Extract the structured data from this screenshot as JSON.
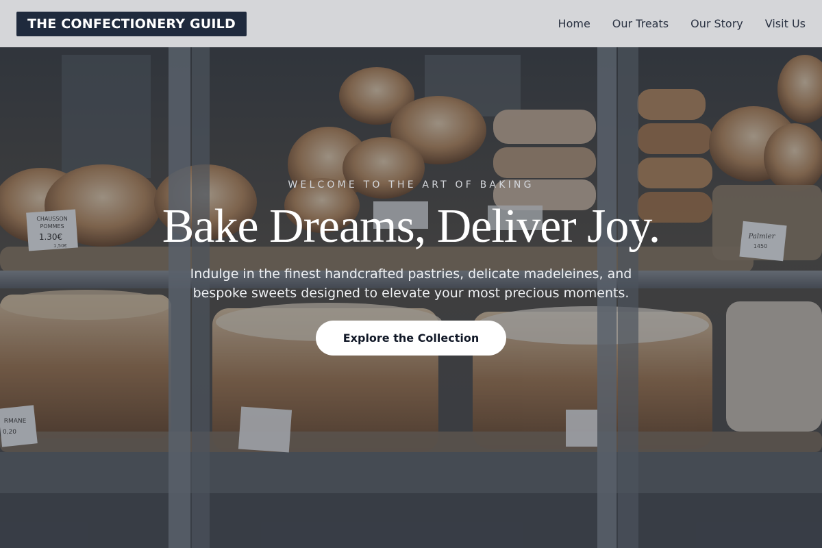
{
  "header": {
    "logo_text": "THE CONFECTIONERY GUILD",
    "nav": [
      {
        "label": "Home"
      },
      {
        "label": "Our Treats"
      },
      {
        "label": "Our Story"
      },
      {
        "label": "Visit Us"
      }
    ]
  },
  "hero": {
    "eyebrow": "WELCOME TO THE ART OF BAKING",
    "headline": "Bake Dreams, Deliver Joy.",
    "subtext": "Indulge in the finest handcrafted pastries, delicate madeleines, and bespoke sweets designed to elevate your most precious moments.",
    "cta_label": "Explore the Collection",
    "background_image": "bakery-display-case-pastries",
    "price_tags": [
      {
        "lines": [
          "CHAUSSON",
          "POMMES",
          "1.30€",
          "1,50€"
        ]
      },
      {
        "lines": [
          "Palmier",
          "1450"
        ]
      },
      {
        "lines": [
          "RMANE",
          "0,20"
        ]
      }
    ]
  },
  "colors": {
    "header_bg": "#e2e3e5",
    "logo_bg": "#1f2a3d",
    "nav_text": "#2a3242",
    "cta_bg": "#ffffff",
    "cta_text": "#111827"
  }
}
